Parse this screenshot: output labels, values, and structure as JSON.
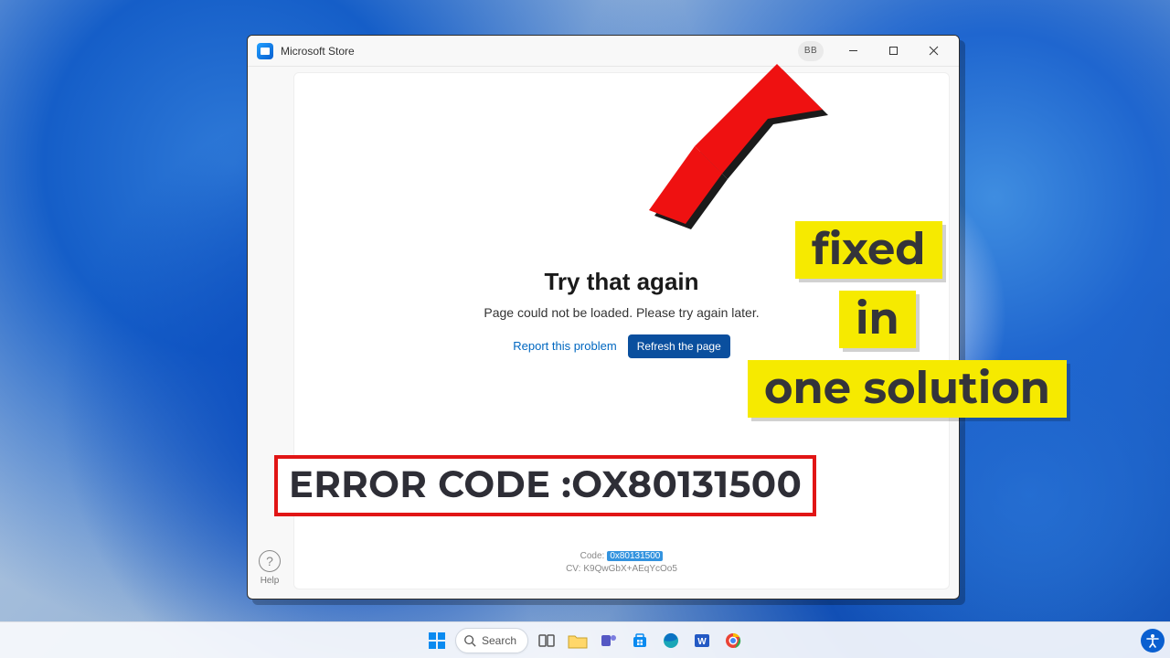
{
  "window": {
    "title": "Microsoft Store",
    "user_initials": "BB"
  },
  "sidebar": {
    "help_label": "Help"
  },
  "error": {
    "title": "Try that again",
    "subtitle": "Page could not be loaded. Please try again later.",
    "report_label": "Report this problem",
    "refresh_label": "Refresh the page",
    "code_label": "Code:",
    "code_value": "0x80131500",
    "cv_label": "CV:",
    "cv_value": "K9QwGbX+AEqYcOo5"
  },
  "overlay": {
    "line1": "fixed",
    "line2": "in",
    "line3": "one solution",
    "error_caption": "ERROR CODE :OX80131500"
  },
  "taskbar": {
    "search_label": "Search"
  }
}
